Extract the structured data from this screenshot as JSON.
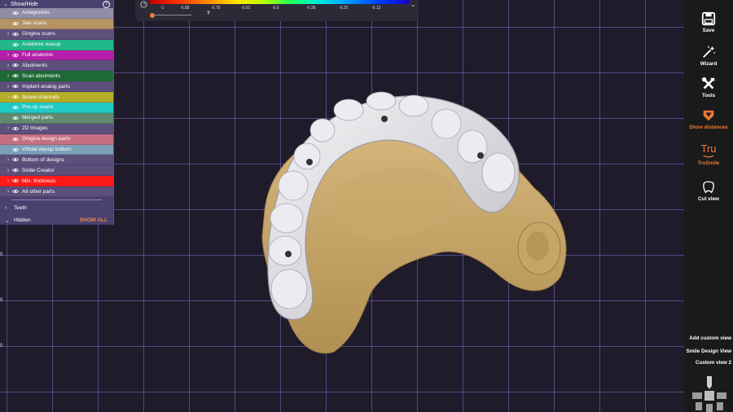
{
  "panel": {
    "header": "Show/Hide",
    "help": "?",
    "items": [
      {
        "label": "Antagonists",
        "color": "#8f8ea6",
        "expand": false,
        "eye": true
      },
      {
        "label": "Jaw scans",
        "color": "#b59364",
        "expand": false,
        "eye": true
      },
      {
        "label": "Gingiva scans",
        "color": "#5c4f7c",
        "expand": true,
        "eye": true
      },
      {
        "label": "Anatomic waxup",
        "color": "#21b98a",
        "expand": false,
        "eye": false
      },
      {
        "label": "Full anatomic",
        "color": "#b51ea8",
        "expand": true,
        "eye": false
      },
      {
        "label": "Abutments",
        "color": "#5c4f7c",
        "expand": true,
        "eye": false
      },
      {
        "label": "Scan abutments",
        "color": "#1e6a36",
        "expand": true,
        "eye": true
      },
      {
        "label": "Implant analog parts",
        "color": "#5c4f7c",
        "expand": true,
        "eye": true
      },
      {
        "label": "Screw channels",
        "color": "#b5ad2a",
        "expand": true,
        "eye": true
      },
      {
        "label": "Pre-op scans",
        "color": "#21c9c4",
        "expand": false,
        "eye": true
      },
      {
        "label": "Merged parts",
        "color": "#5f8a6f",
        "expand": false,
        "eye": true
      },
      {
        "label": "2D Images",
        "color": "#5c4f7c",
        "expand": true,
        "eye": true
      },
      {
        "label": "Gingiva design parts",
        "color": "#c56f82",
        "expand": false,
        "eye": true
      },
      {
        "label": "Virtual waxup bottom",
        "color": "#7aa0b8",
        "expand": false,
        "eye": true
      },
      {
        "label": "Bottom of designs",
        "color": "#5c4f7c",
        "expand": true,
        "eye": true
      },
      {
        "label": "Smile Creator",
        "color": "#5c4f7c",
        "expand": true,
        "eye": true
      },
      {
        "label": "Min. thickness",
        "color": "#ff1a1a",
        "expand": true,
        "eye": true
      },
      {
        "label": "All other parts",
        "color": "#5c4f7c",
        "expand": true,
        "eye": true
      }
    ],
    "teeth": "Teeth",
    "hidden": "Hidden",
    "show_all": "SHOW ALL"
  },
  "legend": {
    "ticks": [
      "-1",
      "-0.88",
      "-0.75",
      "-0.62",
      "-0.5",
      "-0.38",
      "-0.25",
      "-0.12"
    ],
    "question": "?",
    "meter_icon": "gauge-icon",
    "dropdown_icon": "chevron-down-icon"
  },
  "toolbar": {
    "save": "Save",
    "wizard": "Wizard",
    "tools": "Tools",
    "show_distances": "Show distances",
    "trusmile_logo": "Tru",
    "trusmile": "TruSmile",
    "cut_view": "Cut view",
    "add_custom_view": "Add custom view",
    "smile_design_view": "Smile Design View",
    "custom_view_2": "Custom view 2"
  },
  "axis": [
    "0",
    "0",
    "0"
  ],
  "accent": "#f07a36"
}
